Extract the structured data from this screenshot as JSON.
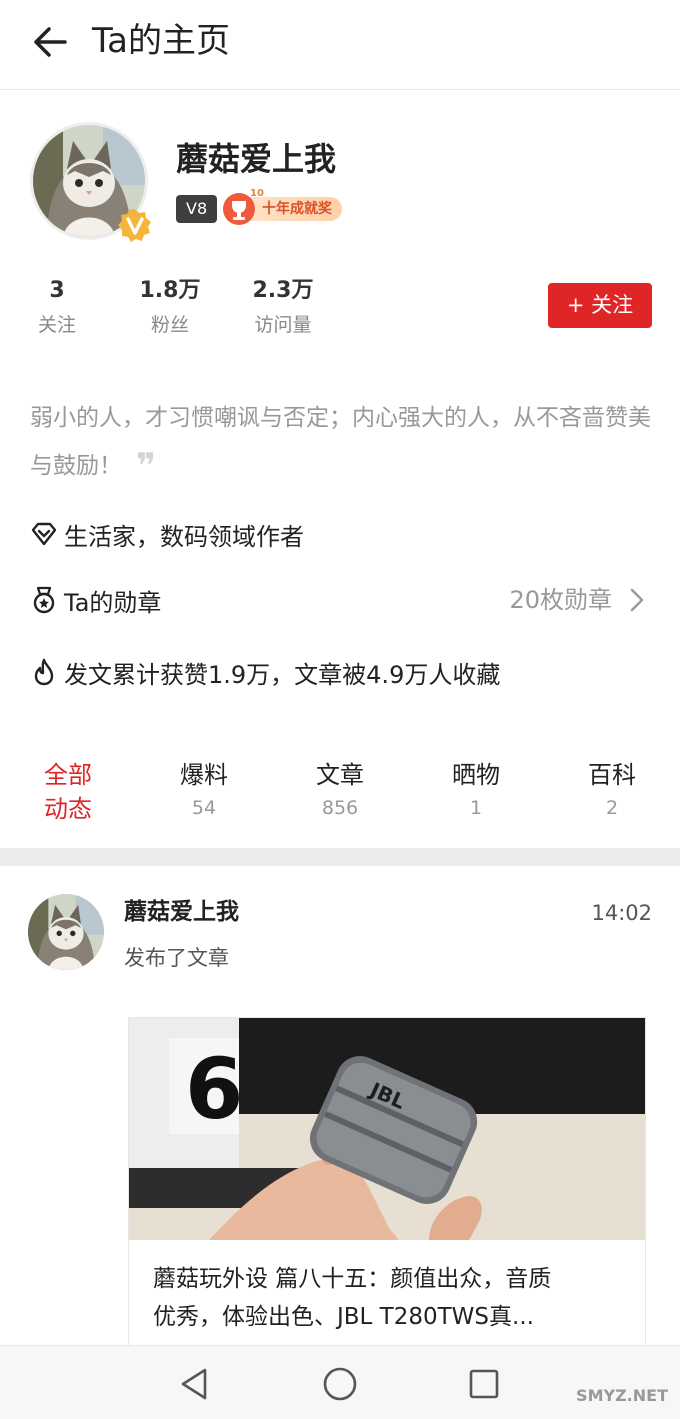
{
  "header": {
    "title": "Ta的主页"
  },
  "profile": {
    "username": "蘑菇爱上我",
    "level": "V8",
    "award": {
      "number": "10",
      "label": "十年成就奖"
    },
    "stats": [
      {
        "num": "3",
        "label": "关注"
      },
      {
        "num": "1.8万",
        "label": "粉丝"
      },
      {
        "num": "2.3万",
        "label": "访问量"
      }
    ],
    "follow_label": "+ 关注",
    "bio": "弱小的人，才习惯嘲讽与否定；内心强大的人，从不吝啬赞美与鼓励！",
    "bio_quote": "❞",
    "tagline": "生活家，数码领域作者",
    "medals_label": "Ta的勋章",
    "medals_count": "20枚勋章",
    "achievement": "发文累计获赞1.9万，文章被4.9万人收藏"
  },
  "tabs": [
    {
      "label": "全部动态",
      "line1": "全部",
      "line2": "动态",
      "count": "",
      "active": true
    },
    {
      "label": "爆料",
      "count": "54"
    },
    {
      "label": "文章",
      "count": "856"
    },
    {
      "label": "晒物",
      "count": "1"
    },
    {
      "label": "百科",
      "count": "2"
    }
  ],
  "feed": {
    "name": "蘑菇爱上我",
    "time": "14:02",
    "action": "发布了文章",
    "card": {
      "title_line1": "蘑菇玩外设 篇八十五：颜值出众，音质",
      "title_line2": "优秀，体验出色、JBL T280TWS真...",
      "image_text": "JBL",
      "image_digit": "6"
    }
  },
  "watermark": "SMYZ.NET",
  "colors": {
    "accent": "#e02527",
    "level_bg": "#3f3f3f",
    "divider": "#ececec"
  }
}
